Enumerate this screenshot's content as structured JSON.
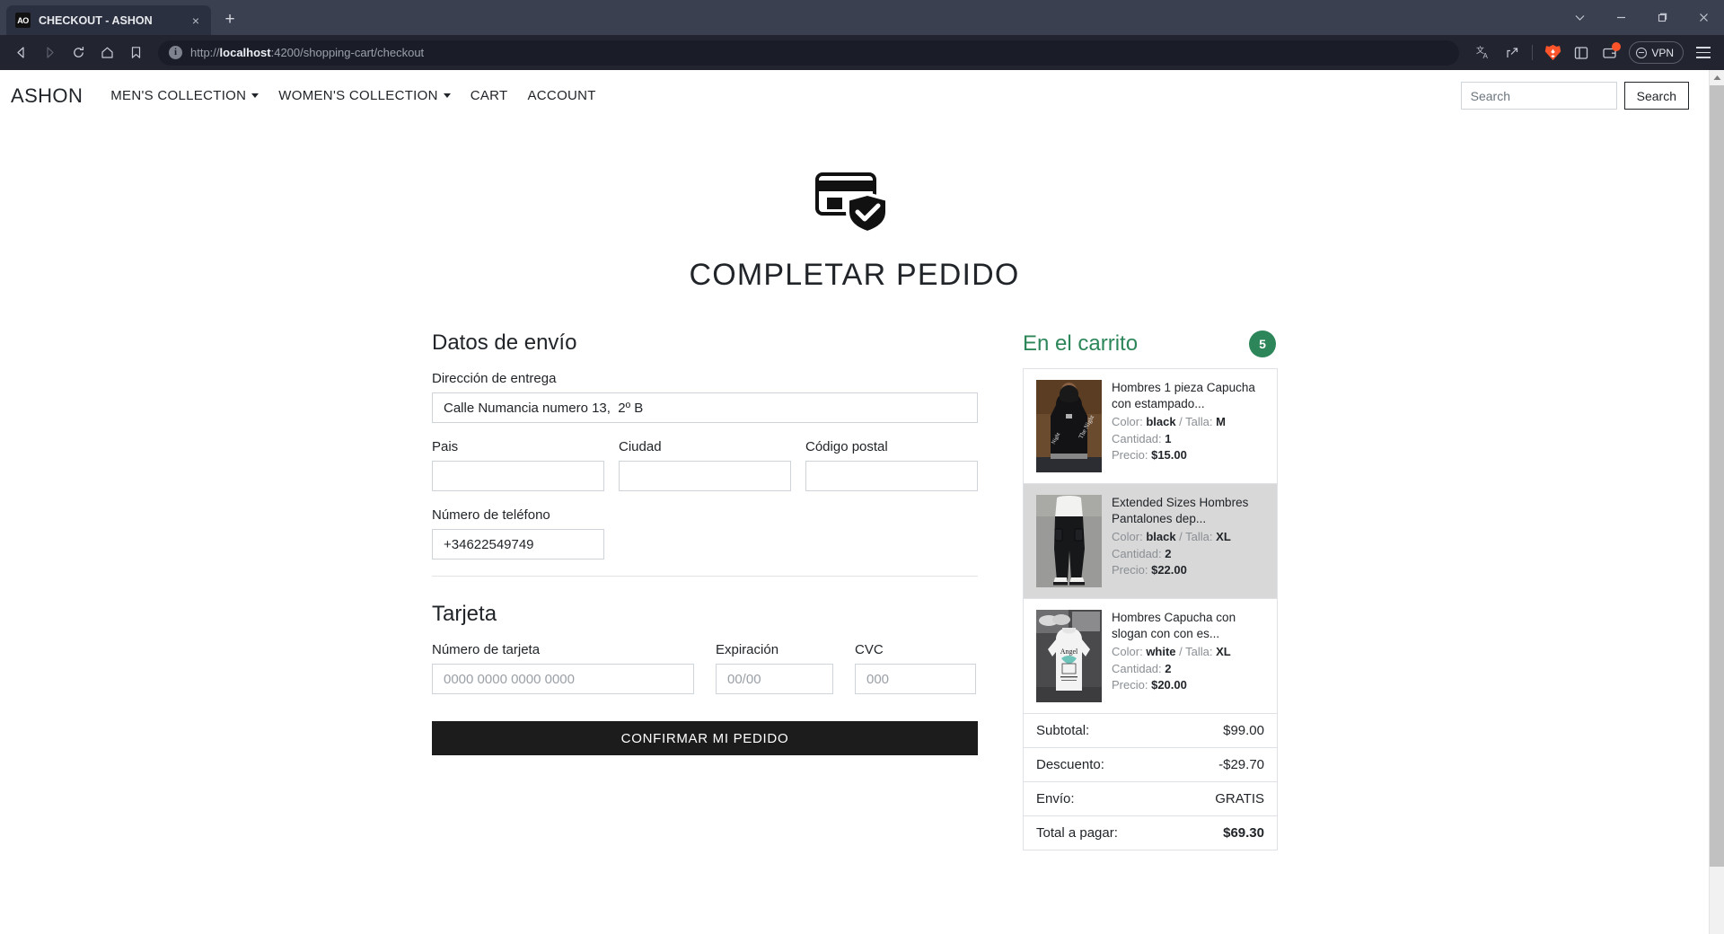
{
  "browser": {
    "tab": {
      "favicon_text": "AO",
      "title": "CHECKOUT - ASHON",
      "close_icon": "×"
    },
    "new_tab_icon": "+",
    "window_controls": {
      "minimize_group": "chevron-down",
      "minimize": "−",
      "restore": "restore",
      "close": "×"
    },
    "nav": {
      "back": "back-icon",
      "forward": "forward-icon",
      "reload": "reload-icon",
      "home": "home-icon",
      "bookmark": "bookmark-icon"
    },
    "url": {
      "scheme": "http://",
      "host": "localhost",
      "rest": ":4200/shopping-cart/checkout",
      "full": "http://localhost:4200/shopping-cart/checkout"
    },
    "toolbar": {
      "translate": "translate-icon",
      "share": "share-icon",
      "brave_shields": "brave-lion-icon",
      "sidebar": "sidebar-panel-icon",
      "wallet": "brave-wallet-icon",
      "vpn_label": "VPN",
      "menu": "hamburger-menu-icon"
    }
  },
  "site": {
    "brand": "ASHON",
    "nav_items": [
      {
        "label": "MEN'S COLLECTION",
        "has_caret": true
      },
      {
        "label": "WOMEN'S COLLECTION",
        "has_caret": true
      },
      {
        "label": "CART",
        "has_caret": false
      },
      {
        "label": "ACCOUNT",
        "has_caret": false
      }
    ],
    "search": {
      "placeholder": "Search",
      "value": "",
      "button_label": "Search"
    }
  },
  "hero": {
    "icon": "credit-card-shield-check-icon",
    "title": "COMPLETAR PEDIDO"
  },
  "shipping": {
    "section_title": "Datos de envío",
    "address": {
      "label": "Dirección de entrega",
      "value": "Calle Numancia numero 13,  2º B",
      "placeholder": ""
    },
    "country": {
      "label": "Pais",
      "value": "",
      "placeholder": ""
    },
    "city": {
      "label": "Ciudad",
      "value": "",
      "placeholder": ""
    },
    "postal": {
      "label": "Código postal",
      "value": "",
      "placeholder": ""
    },
    "phone": {
      "label": "Número de teléfono",
      "value": "+34622549749",
      "placeholder": ""
    }
  },
  "card": {
    "section_title": "Tarjeta",
    "number": {
      "label": "Número de tarjeta",
      "value": "",
      "placeholder": "0000 0000 0000 0000"
    },
    "expiry": {
      "label": "Expiración",
      "value": "",
      "placeholder": "00/00"
    },
    "cvc": {
      "label": "CVC",
      "value": "",
      "placeholder": "000"
    },
    "submit_label": "CONFIRMAR MI PEDIDO"
  },
  "cart": {
    "title": "En el carrito",
    "count": "5",
    "accent_color": "#2d8659",
    "items": [
      {
        "name": "Hombres 1 pieza Capucha con estampado...",
        "color_label": "Color:",
        "color": "black",
        "size_label": "Talla:",
        "size": "M",
        "qty_label": "Cantidad:",
        "qty": "1",
        "price_label": "Precio:",
        "price": "$15.00",
        "thumb": "black-hoodie-photo",
        "hovered": false
      },
      {
        "name": "Extended Sizes Hombres Pantalones dep...",
        "color_label": "Color:",
        "color": "black",
        "size_label": "Talla:",
        "size": "XL",
        "qty_label": "Cantidad:",
        "qty": "2",
        "price_label": "Precio:",
        "price": "$22.00",
        "thumb": "black-cargo-pants-photo",
        "hovered": true
      },
      {
        "name": "Hombres Capucha con slogan con con es...",
        "color_label": "Color:",
        "color": "white",
        "size_label": "Talla:",
        "size": "XL",
        "qty_label": "Cantidad:",
        "qty": "2",
        "price_label": "Precio:",
        "price": "$20.00",
        "thumb": "white-angel-hoodie-photo",
        "hovered": false
      }
    ],
    "totals": [
      {
        "label": "Subtotal:",
        "value": "$99.00",
        "grand": false
      },
      {
        "label": "Descuento:",
        "value": "-$29.70",
        "grand": false
      },
      {
        "label": "Envío:",
        "value": "GRATIS",
        "grand": false
      },
      {
        "label": "Total a pagar:",
        "value": "$69.30",
        "grand": true
      }
    ]
  }
}
